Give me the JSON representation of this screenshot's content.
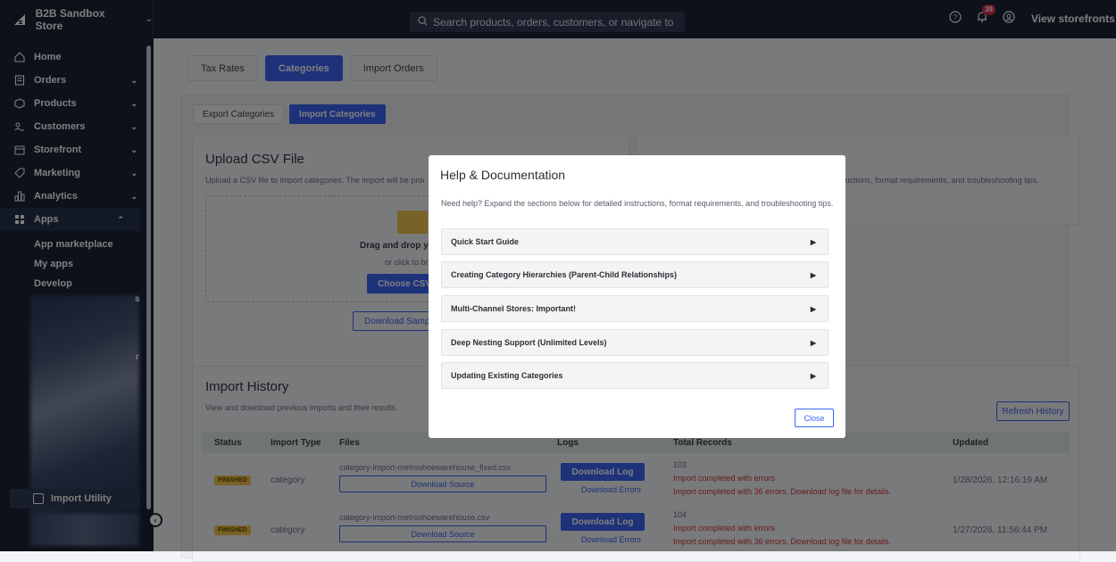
{
  "topbar": {
    "store_name": "B2B Sandbox Store",
    "search_placeholder": "Search products, orders, customers, or navigate to",
    "notification_count": "39",
    "view_storefronts": "View storefronts"
  },
  "sidebar": {
    "items": [
      {
        "label": "Home",
        "icon": "home-icon"
      },
      {
        "label": "Orders",
        "icon": "orders-icon"
      },
      {
        "label": "Products",
        "icon": "products-icon"
      },
      {
        "label": "Customers",
        "icon": "customers-icon"
      },
      {
        "label": "Storefront",
        "icon": "storefront-icon"
      },
      {
        "label": "Marketing",
        "icon": "marketing-icon"
      },
      {
        "label": "Analytics",
        "icon": "analytics-icon"
      },
      {
        "label": "Apps",
        "icon": "apps-icon"
      }
    ],
    "apps_sub": [
      "App marketplace",
      "My apps",
      "Develop"
    ],
    "stray_chars": [
      "s",
      "r"
    ],
    "import_utility": "Import Utility"
  },
  "main": {
    "tabs": [
      "Tax Rates",
      "Categories",
      "Import Orders"
    ],
    "subtabs": [
      "Export Categories",
      "Import Categories"
    ],
    "upload": {
      "title": "Upload CSV File",
      "desc": "Upload a CSV file to import categories. The import will be proc",
      "dz_text": "Drag and drop your C",
      "dz_or": "or click to brows",
      "choose": "Choose CSV",
      "download_sample": "Download Sample"
    },
    "help_card": {
      "desc": "tructions, format requirements, and troubleshooting tips."
    },
    "history": {
      "title": "Import History",
      "desc": "View and download previous imports and their results.",
      "refresh": "Refresh History",
      "headers": [
        "Status",
        "Import Type",
        "Files",
        "Logs",
        "Total Records",
        "Updated"
      ],
      "rows": [
        {
          "status": "FINISHED",
          "type": "category",
          "file": "category-import-metroshoewarehouse_fixed.csv",
          "download_source": "Download Source",
          "download_log": "Download Log",
          "download_errors": "Download Errors",
          "count": "103",
          "line1": "Import completed with errors",
          "line2": "Import completed with 36 errors. Download log file for details.",
          "updated": "1/28/2026, 12:16:19 AM"
        },
        {
          "status": "FINISHED",
          "type": "category",
          "file": "category-import-metroshoewarehouse.csv",
          "download_source": "Download Source",
          "download_log": "Download Log",
          "download_errors": "Download Errors",
          "count": "104",
          "line1": "Import completed with errors",
          "line2": "Import completed with 36 errors. Download log file for details.",
          "updated": "1/27/2026, 11:56:44 PM"
        }
      ]
    }
  },
  "modal": {
    "title": "Help & Documentation",
    "desc": "Need help? Expand the sections below for detailed instructions, format requirements, and troubleshooting tips.",
    "sections": [
      "Quick Start Guide",
      "Creating Category Hierarchies (Parent-Child Relationships)",
      "Multi-Channel Stores: Important!",
      "Deep Nesting Support (Unlimited Levels)",
      "Updating Existing Categories"
    ],
    "close": "Close"
  },
  "colors": {
    "sidebar_bg": "#1a2235",
    "accent": "#3c64f4",
    "finished_badge": "#f0c44f",
    "error_text": "#d1363f"
  }
}
